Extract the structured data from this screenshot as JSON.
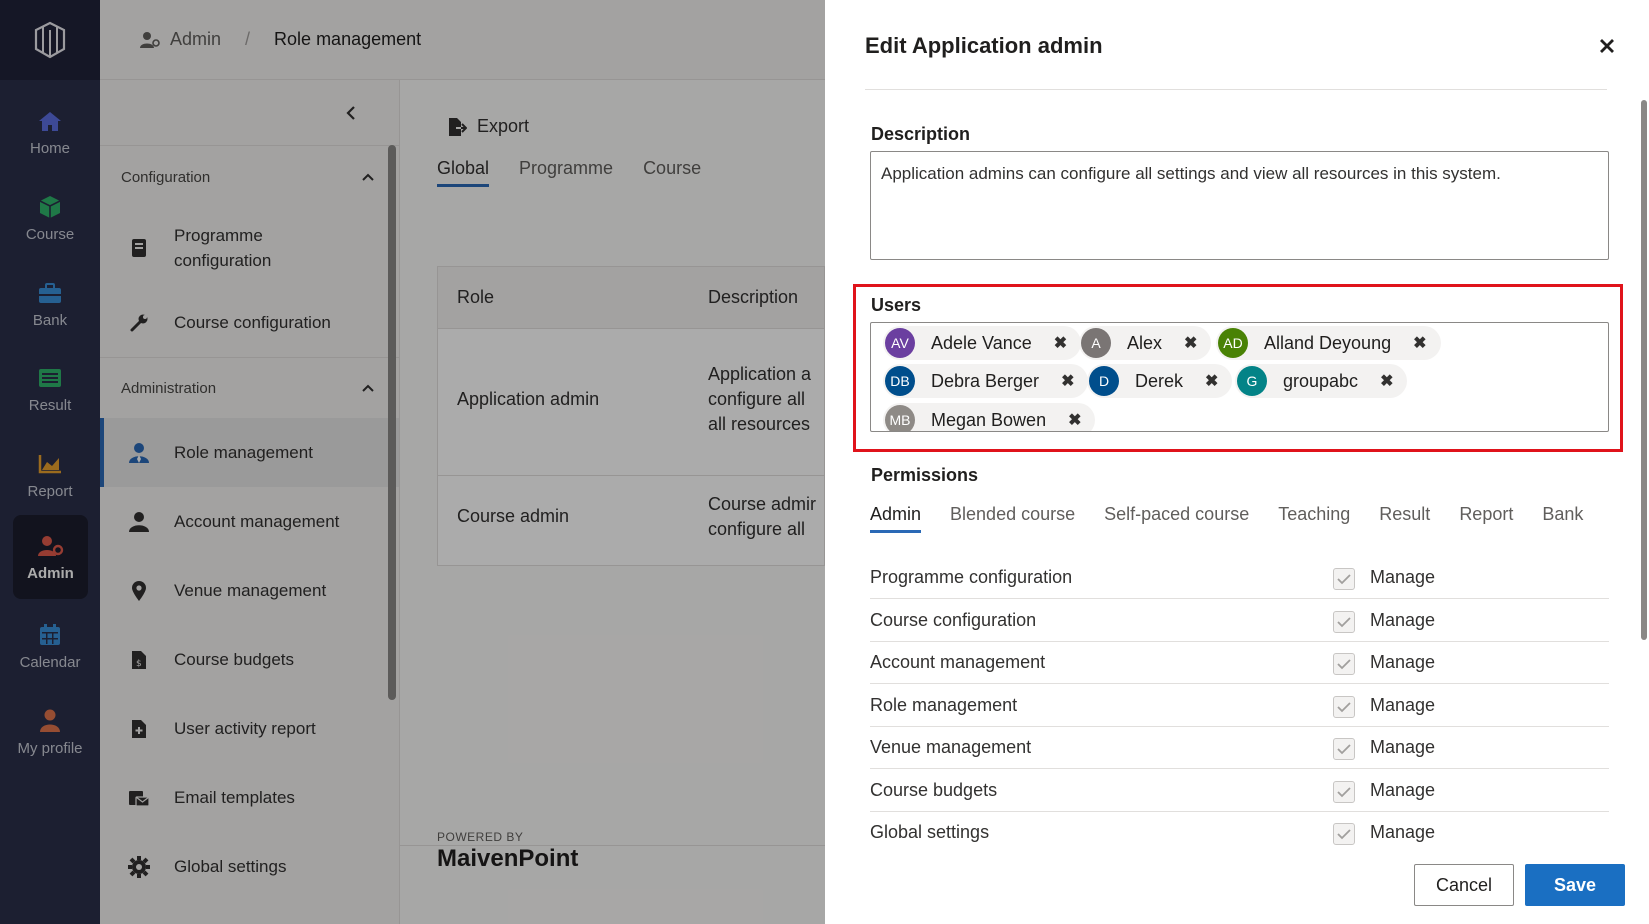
{
  "rail": {
    "items": [
      {
        "label": "Home",
        "icon": "home-icon",
        "color": "#5b6de0"
      },
      {
        "label": "Course",
        "icon": "cube-icon",
        "color": "#2fb46b"
      },
      {
        "label": "Bank",
        "icon": "briefcase-icon",
        "color": "#3a8fd9"
      },
      {
        "label": "Result",
        "icon": "list-icon",
        "color": "#2fb46b"
      },
      {
        "label": "Report",
        "icon": "chart-icon",
        "color": "#e8a02d"
      },
      {
        "label": "Admin",
        "icon": "user-gear-icon",
        "color": "#e05a4b"
      },
      {
        "label": "Calendar",
        "icon": "calendar-icon",
        "color": "#3a8fd9"
      },
      {
        "label": "My profile",
        "icon": "person-icon",
        "color": "#e0734b"
      }
    ],
    "active": "Admin"
  },
  "topbar": {
    "crumb_root": "Admin",
    "crumb_current": "Role management"
  },
  "subnav": {
    "group_config": "Configuration",
    "config_items": [
      "Programme configuration",
      "Course configuration"
    ],
    "group_admin": "Administration",
    "admin_items": [
      "Role management",
      "Account management",
      "Venue management",
      "Course budgets",
      "User activity report",
      "Email templates",
      "Global settings"
    ]
  },
  "main": {
    "export_label": "Export",
    "tabs": [
      "Global",
      "Programme",
      "Course"
    ],
    "table": {
      "headers": [
        "Role",
        "Description"
      ],
      "rows": [
        {
          "role": "Application admin",
          "desc": [
            "Application a",
            "configure all",
            "all resources"
          ]
        },
        {
          "role": "Course admin",
          "desc": [
            "Course admir",
            "configure all"
          ]
        }
      ]
    },
    "powered_by": "POWERED BY",
    "brand": "MaivenPoint"
  },
  "panel": {
    "title": "Edit Application admin",
    "description_label": "Description",
    "description_value": "Application admins can configure all settings and view all resources in this system.",
    "users_label": "Users",
    "users": [
      {
        "initials": "AV",
        "name": "Adele Vance",
        "color": "#6b3fa0"
      },
      {
        "initials": "A",
        "name": "Alex",
        "color": "#7a7574"
      },
      {
        "initials": "AD",
        "name": "Alland Deyoung",
        "color": "#498205"
      },
      {
        "initials": "DB",
        "name": "Debra Berger",
        "color": "#004e8c"
      },
      {
        "initials": "D",
        "name": "Derek",
        "color": "#004e8c"
      },
      {
        "initials": "G",
        "name": "groupabc",
        "color": "#038387"
      },
      {
        "initials": "MB",
        "name": "Megan Bowen",
        "color": "#8e8a86"
      }
    ],
    "permissions_label": "Permissions",
    "perm_tabs": [
      "Admin",
      "Blended course",
      "Self-paced course",
      "Teaching",
      "Result",
      "Report",
      "Bank"
    ],
    "perm_rows": [
      {
        "name": "Programme configuration",
        "level": "Manage"
      },
      {
        "name": "Course configuration",
        "level": "Manage"
      },
      {
        "name": "Account management",
        "level": "Manage"
      },
      {
        "name": "Role management",
        "level": "Manage"
      },
      {
        "name": "Venue management",
        "level": "Manage"
      },
      {
        "name": "Course budgets",
        "level": "Manage"
      },
      {
        "name": "Global settings",
        "level": "Manage"
      }
    ],
    "cancel_label": "Cancel",
    "save_label": "Save"
  }
}
